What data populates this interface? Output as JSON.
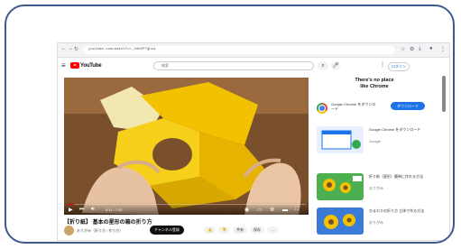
{
  "browser": {
    "url": "youtube.com/watch?v=_4dKSP7Qhiw"
  },
  "youtube": {
    "logo_text": "YouTube",
    "search_placeholder": "検索",
    "signin_label": "ログイン"
  },
  "promo": {
    "title_line1": "There's no place",
    "title_line2": "like Chrome",
    "text": "Google Chrome をダウンロード",
    "button_label": "ダウンロード"
  },
  "video": {
    "title": "【折り紙】 基本の星形の箱の折り方",
    "channel": "おりがみ（折り方 / 作り方）",
    "time": "0:11 / 7:31",
    "progress": 0.03,
    "subscribe_label": "チャンネル登録"
  },
  "actions": [
    "👍",
    "👎",
    "共有",
    "保存",
    "…"
  ],
  "recommendations": [
    {
      "title": "Google Chrome をダウンロード",
      "meta": "Google"
    },
    {
      "title": "折り紙（星形）簡単に作れる方法",
      "meta": "おりがみ"
    },
    {
      "title": "ひまわりの折り方 立体で作る方法",
      "meta": "おりがみ"
    }
  ],
  "colors": {
    "frame": "#3d5a8f",
    "youtube_red": "#ff0000",
    "download_blue": "#1a73e8",
    "origami_yellow": "#f2c200"
  }
}
